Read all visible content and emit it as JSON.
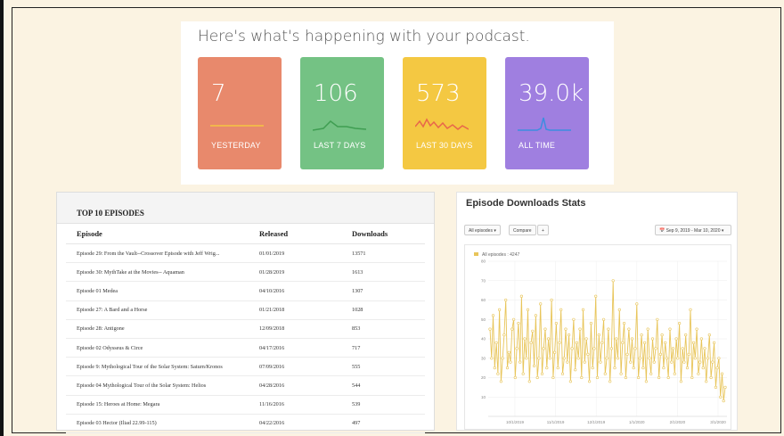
{
  "stats": {
    "heading": "Here's what's happening with your podcast.",
    "cards": [
      {
        "value": "7",
        "label": "YESTERDAY",
        "color": "#e8896c",
        "spark_color": "#f5c542",
        "spark": "flat"
      },
      {
        "value": "106",
        "label": "LAST 7 DAYS",
        "color": "#74c284",
        "spark_color": "#3f9e52",
        "spark": "bump"
      },
      {
        "value": "573",
        "label": "LAST 30 DAYS",
        "color": "#f4c842",
        "spark_color": "#e8674a",
        "spark": "jagged"
      },
      {
        "value": "39.0k",
        "label": "ALL TIME",
        "color": "#9f7fe0",
        "spark_color": "#3b8ee0",
        "spark": "spike"
      }
    ]
  },
  "top_episodes": {
    "title": "TOP 10 EPISODES",
    "columns": [
      "Episode",
      "Released",
      "Downloads"
    ],
    "rows": [
      [
        "Episode 29: From the Vault--Crossover Episode with Jeff Wrig...",
        "01/01/2019",
        "13571"
      ],
      [
        "Episode 30: MythTake at the Movies-- Aquaman",
        "01/28/2019",
        "1613"
      ],
      [
        "Episode 01 Medea",
        "04/10/2016",
        "1307"
      ],
      [
        "Episode 27: A Bard and a Horse",
        "01/21/2018",
        "1028"
      ],
      [
        "Episode 28: Antigone",
        "12/09/2018",
        "853"
      ],
      [
        "Episode 02 Odysseus & Circe",
        "04/17/2016",
        "717"
      ],
      [
        "Episode 9: Mythological Tour of the Solar System: Saturn/Kronos",
        "07/09/2016",
        "555"
      ],
      [
        "Episode 04 Mythological Tour of the Solar System: Helios",
        "04/28/2016",
        "544"
      ],
      [
        "Episode 15: Heroes at Home: Megara",
        "11/16/2016",
        "539"
      ],
      [
        "Episode 03 Hector (Iliad 22.99-115)",
        "04/22/2016",
        "497"
      ]
    ]
  },
  "downloads_stats": {
    "title": "Episode Downloads Stats",
    "all_episodes_btn": "All episodes ▾",
    "compare_btn": "Compare",
    "plus_btn": "+",
    "date_range": "📅 Sep 9, 2019 - Mar 10, 2020 ▾"
  },
  "chart_data": {
    "type": "line",
    "legend": "All episodes : 4247",
    "series_color": "#e8c55a",
    "ylim": [
      0,
      80
    ],
    "yticks": [
      "10",
      "20",
      "30",
      "40",
      "50",
      "60",
      "70",
      "80"
    ],
    "xticks": [
      "10/1/2019",
      "11/1/2019",
      "12/1/2019",
      "1/1/2020",
      "2/1/2020",
      "3/1/2020"
    ],
    "series": [
      {
        "values": [
          45,
          30,
          52,
          25,
          38,
          22,
          55,
          18,
          30,
          42,
          60,
          25,
          33,
          28,
          45,
          50,
          20,
          35,
          48,
          28,
          62,
          22,
          40,
          30,
          55,
          18,
          38,
          44,
          26,
          52,
          20,
          30,
          58,
          22,
          35,
          45,
          25,
          40,
          30,
          60,
          20,
          33,
          48,
          25,
          38,
          55,
          22,
          30,
          45,
          28,
          42,
          18,
          35,
          50,
          24,
          38,
          30,
          45,
          20,
          55,
          28,
          40,
          32,
          18,
          48,
          25,
          35,
          62,
          20,
          42,
          28,
          38,
          50,
          22,
          30,
          45,
          18,
          35,
          70,
          25,
          40,
          30,
          55,
          22,
          38,
          48,
          20,
          32,
          45,
          28,
          40,
          25,
          35,
          58,
          20,
          30,
          42,
          25,
          38,
          18,
          45,
          30,
          22,
          40,
          28,
          35,
          50,
          20,
          32,
          42,
          25,
          38,
          30,
          20,
          45,
          28,
          35,
          22,
          40,
          30,
          48,
          18,
          35,
          28,
          42,
          25,
          32,
          55,
          20,
          38,
          30,
          45,
          22,
          28,
          40,
          25,
          35,
          18,
          30,
          42,
          20,
          28,
          38,
          15,
          25,
          30,
          10,
          22,
          8,
          15
        ]
      }
    ]
  }
}
